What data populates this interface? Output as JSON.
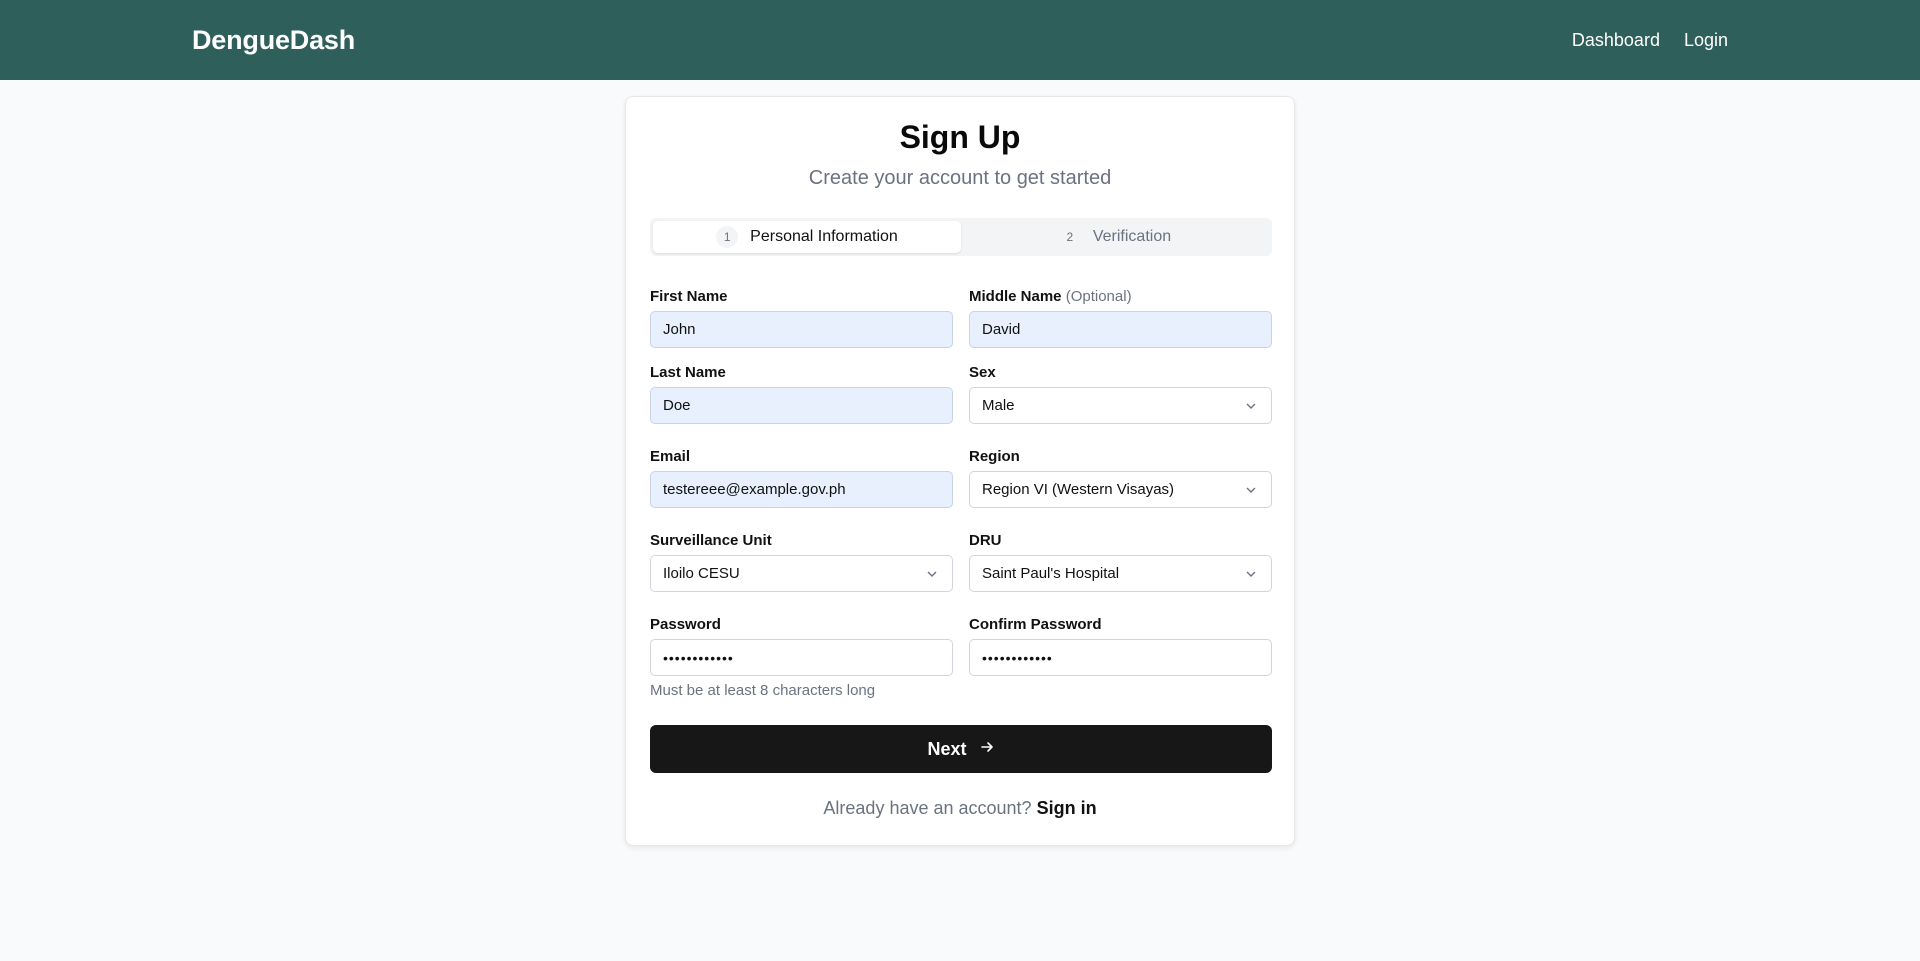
{
  "navbar": {
    "brand": "DengueDash",
    "links": [
      "Dashboard",
      "Login"
    ]
  },
  "card": {
    "title": "Sign Up",
    "subtitle": "Create your account to get started",
    "tabs": [
      {
        "num": "1",
        "label": "Personal Information",
        "active": true
      },
      {
        "num": "2",
        "label": "Verification",
        "active": false
      }
    ]
  },
  "form": {
    "first_name": {
      "label": "First Name",
      "value": "John"
    },
    "middle_name": {
      "label": "Middle Name",
      "optional": "(Optional)",
      "value": "David"
    },
    "last_name": {
      "label": "Last Name",
      "value": "Doe"
    },
    "sex": {
      "label": "Sex",
      "value": "Male"
    },
    "email": {
      "label": "Email",
      "value": "testereee@example.gov.ph"
    },
    "region": {
      "label": "Region",
      "value": "Region VI (Western Visayas)"
    },
    "surveillance_unit": {
      "label": "Surveillance Unit",
      "value": "Iloilo CESU"
    },
    "dru": {
      "label": "DRU",
      "value": "Saint Paul's Hospital"
    },
    "password": {
      "label": "Password",
      "value": "••••••••••••"
    },
    "confirm_password": {
      "label": "Confirm Password",
      "value": "••••••••••••"
    },
    "password_hint": "Must be at least 8 characters long"
  },
  "actions": {
    "next_label": "Next",
    "signin_prompt": "Already have an account?",
    "signin_link": "Sign in"
  }
}
